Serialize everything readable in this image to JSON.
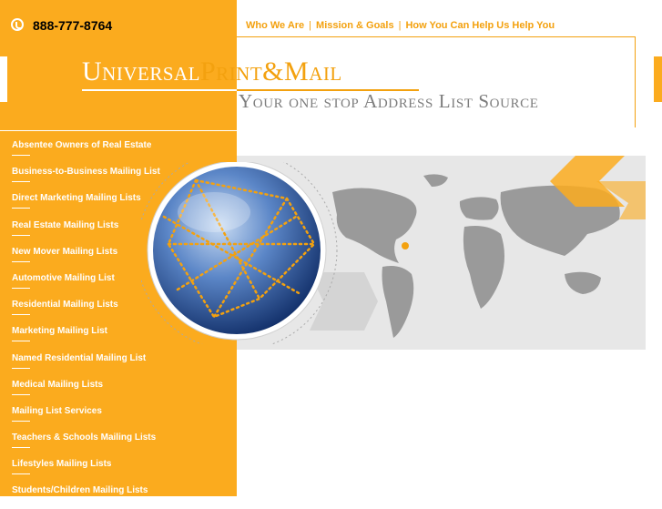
{
  "header": {
    "phone": "888-777-8764",
    "nav": [
      {
        "label": "Who We Are"
      },
      {
        "label": "Mission & Goals"
      },
      {
        "label": "How You Can Help Us Help You"
      }
    ],
    "logo_part1": "Universal",
    "logo_part2": "Print&Mail",
    "tagline": "Your one stop Address List Source"
  },
  "sidebar": {
    "items": [
      {
        "label": "Absentee Owners of Real Estate"
      },
      {
        "label": "Business-to-Business Mailing List"
      },
      {
        "label": "Direct Marketing Mailing Lists"
      },
      {
        "label": "Real Estate Mailing Lists"
      },
      {
        "label": "New Mover Mailing Lists"
      },
      {
        "label": "Automotive Mailing List"
      },
      {
        "label": "Residential Mailing Lists"
      },
      {
        "label": "Marketing Mailing List"
      },
      {
        "label": "Named Residential Mailing List"
      },
      {
        "label": "Medical Mailing Lists"
      },
      {
        "label": "Mailing List Services"
      },
      {
        "label": "Teachers & Schools Mailing Lists"
      },
      {
        "label": "Lifestyles Mailing Lists"
      },
      {
        "label": "Students/Children Mailing Lists"
      }
    ]
  },
  "colors": {
    "brand_orange": "#fbab1e",
    "accent_orange": "#f3a10f",
    "globe_blue": "#2d5fa8",
    "map_gray": "#9a9a9a"
  },
  "icons": {
    "phone": "phone-icon",
    "globe": "globe-icon",
    "map": "world-map"
  }
}
